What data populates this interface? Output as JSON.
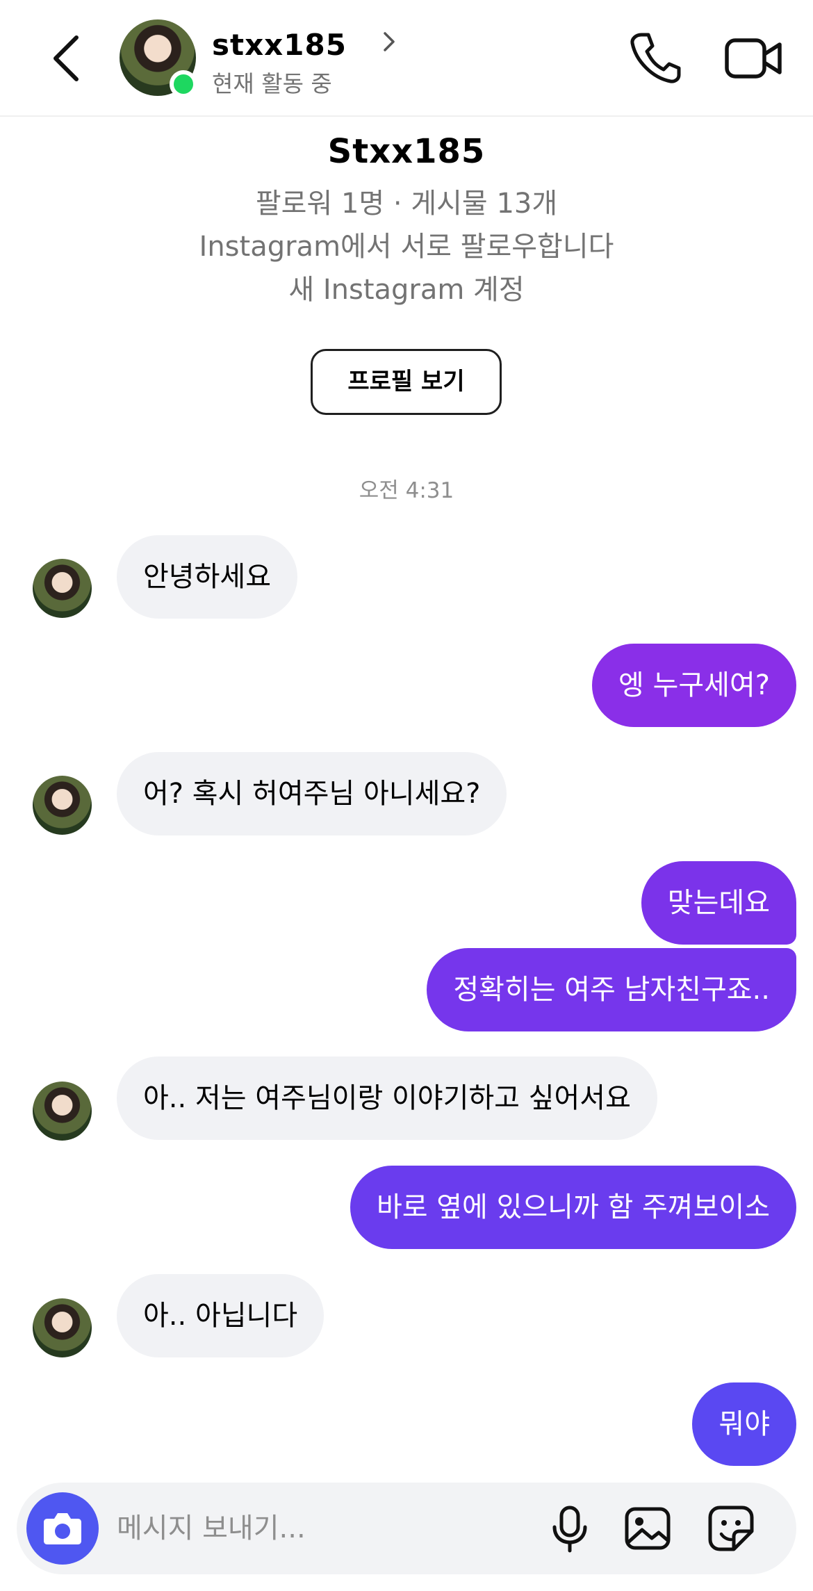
{
  "header": {
    "username": "stxx185",
    "status": "현재 활동 중"
  },
  "intro": {
    "name": "Stxx185",
    "stats": "팔로워 1명 · 게시물 13개",
    "mutual": "Instagram에서 서로 팔로우합니다",
    "new_account": "새 Instagram 계정",
    "profile_button": "프로필 보기"
  },
  "timestamp": "오전 4:31",
  "messages": [
    {
      "side": "in",
      "text": "안녕하세요",
      "avatar": true
    },
    {
      "side": "out",
      "text": "엥 누구세여?",
      "color": "#8a2fe8"
    },
    {
      "side": "in",
      "text": "어? 혹시 허여주님 아니세요?",
      "avatar": true
    },
    {
      "side": "out",
      "text": "맞는데요",
      "color": "#7b33ea"
    },
    {
      "side": "out",
      "text": "정확히는 여주 남자친구죠..",
      "color": "#7636ec"
    },
    {
      "side": "in",
      "text": "아.. 저는 여주님이랑 이야기하고 싶어서요",
      "avatar": true
    },
    {
      "side": "out",
      "text": "바로 옆에 있으니까 함 주껴보이소",
      "color": "#6a3cee"
    },
    {
      "side": "in",
      "text": "아.. 아닙니다",
      "avatar": true
    },
    {
      "side": "out",
      "text": "뭐야",
      "color": "#5a48f2"
    }
  ],
  "composer": {
    "placeholder": "메시지 보내기..."
  },
  "colors": {
    "online": "#1ed760",
    "camera_button": "#4f57f1",
    "incoming_bubble": "#f1f2f5"
  }
}
